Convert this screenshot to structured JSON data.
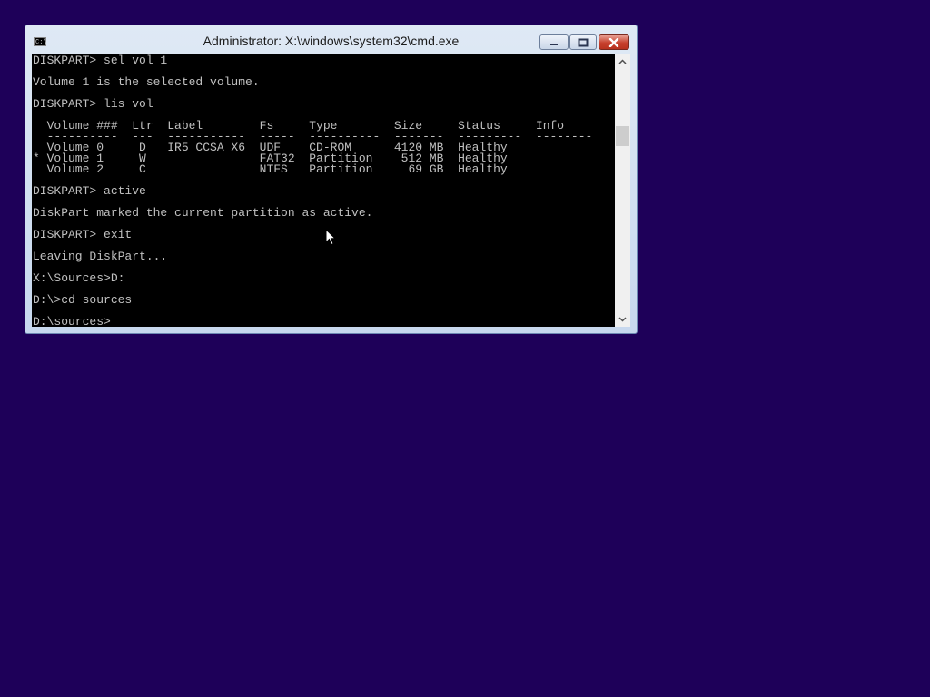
{
  "window": {
    "title": "Administrator: X:\\windows\\system32\\cmd.exe",
    "icon": "cmd-icon",
    "icon_text": "C:\\"
  },
  "console": {
    "lines": [
      "DISKPART> sel vol 1",
      "",
      "Volume 1 is the selected volume.",
      "",
      "DISKPART> lis vol",
      "",
      "  Volume ###  Ltr  Label        Fs     Type        Size     Status     Info",
      "  ----------  ---  -----------  -----  ----------  -------  ---------  --------",
      "  Volume 0     D   IR5_CCSA_X6  UDF    CD-ROM      4120 MB  Healthy",
      "* Volume 1     W                FAT32  Partition    512 MB  Healthy",
      "  Volume 2     C                NTFS   Partition     69 GB  Healthy",
      "",
      "DISKPART> active",
      "",
      "DiskPart marked the current partition as active.",
      "",
      "DISKPART> exit",
      "",
      "Leaving DiskPart...",
      "",
      "X:\\Sources>D:",
      "",
      "D:\\>cd sources",
      "",
      "D:\\sources>"
    ]
  },
  "colors": {
    "desktop": "#1e0059",
    "console_bg": "#000000",
    "console_text": "#c0c0c0",
    "close_button": "#c7412e"
  }
}
